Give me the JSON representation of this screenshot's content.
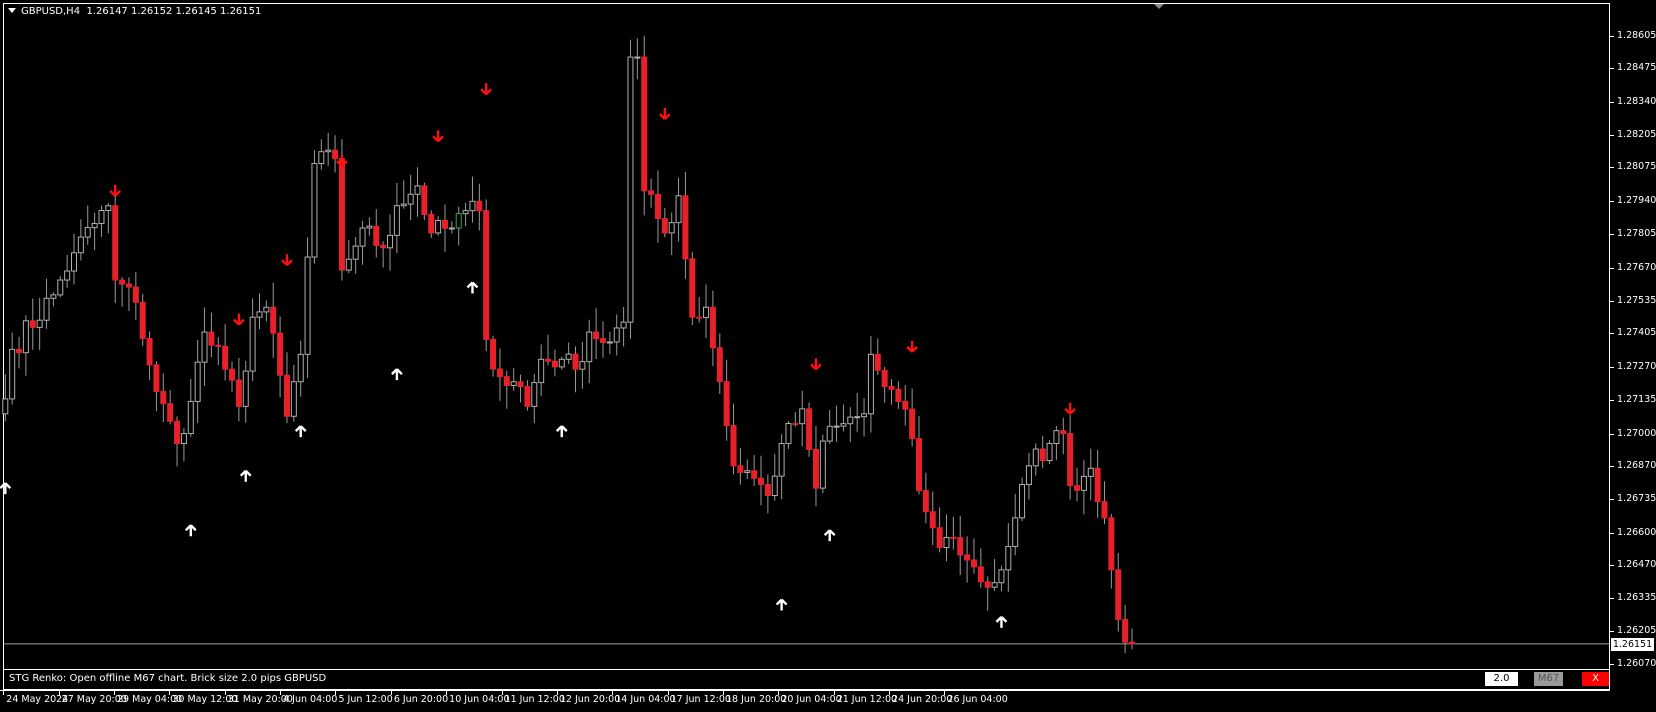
{
  "header": {
    "symbol": "GBPUSD,H4",
    "ohlc": "1.26147 1.26152 1.26145 1.26151"
  },
  "panel": {
    "message": "STG Renko: Open offline M67 chart. Brick size 2.0 pips GBPUSD",
    "brick_value": "2.0",
    "timeframe_button": "M67",
    "close_button": "X"
  },
  "colors": {
    "bear": "#e8202a",
    "bull_border": "#b0b0b0",
    "wick": "#9a9a9a",
    "bull_special": "#2ea84a",
    "down_arrow": "#ff1010",
    "up_arrow": "#ffffff",
    "price_line": "#9aa0aa"
  },
  "chart_data": {
    "type": "candlestick",
    "title": "GBPUSD,H4",
    "current_price": "1.26151",
    "ylim": [
      1.2607,
      1.28605
    ],
    "yticks": [
      "1.28605",
      "1.28475",
      "1.28340",
      "1.28205",
      "1.28075",
      "1.27940",
      "1.27805",
      "1.27670",
      "1.27535",
      "1.27405",
      "1.27270",
      "1.27135",
      "1.27000",
      "1.26870",
      "1.26735",
      "1.26600",
      "1.26470",
      "1.26335",
      "1.26205",
      "1.26070"
    ],
    "xticks": [
      "24 May 2024",
      "27 May 20:00",
      "29 May 04:00",
      "30 May 12:00",
      "31 May 20:00",
      "4 Jun 04:00",
      "5 Jun 12:00",
      "6 Jun 20:00",
      "10 Jun 04:00",
      "11 Jun 12:00",
      "12 Jun 20:00",
      "14 Jun 04:00",
      "17 Jun 12:00",
      "18 Jun 20:00",
      "20 Jun 04:00",
      "21 Jun 12:00",
      "24 Jun 20:00",
      "26 Jun 04:00"
    ],
    "bars_per_xtick": 8,
    "bar_count": 165,
    "close_path": [
      [
        0,
        1.2714
      ],
      [
        1,
        1.2734
      ],
      [
        7,
        1.2756
      ],
      [
        10,
        1.2773
      ],
      [
        15,
        1.2792
      ],
      [
        16,
        1.2762
      ],
      [
        19,
        1.2753
      ],
      [
        22,
        1.2717
      ],
      [
        25,
        1.2696
      ],
      [
        27,
        1.2713
      ],
      [
        29,
        1.2741
      ],
      [
        32,
        1.2726
      ],
      [
        34,
        1.2711
      ],
      [
        36,
        1.2747
      ],
      [
        38,
        1.2751
      ],
      [
        41,
        1.2707
      ],
      [
        43,
        1.2732
      ],
      [
        45,
        1.2809
      ],
      [
        48,
        1.2811
      ],
      [
        49,
        1.2766
      ],
      [
        52,
        1.2783
      ],
      [
        55,
        1.2775
      ],
      [
        57,
        1.2792
      ],
      [
        60,
        1.28
      ],
      [
        62,
        1.2781
      ],
      [
        65,
        1.2783
      ],
      [
        67,
        1.279
      ],
      [
        69,
        1.279
      ],
      [
        70,
        1.2738
      ],
      [
        72,
        1.2723
      ],
      [
        75,
        1.2719
      ],
      [
        76,
        1.2711
      ],
      [
        78,
        1.273
      ],
      [
        81,
        1.273
      ],
      [
        83,
        1.2726
      ],
      [
        85,
        1.2741
      ],
      [
        88,
        1.2737
      ],
      [
        90,
        1.2745
      ],
      [
        91,
        1.2852
      ],
      [
        92,
        1.2852
      ],
      [
        93,
        1.2798
      ],
      [
        96,
        1.2781
      ],
      [
        98,
        1.2796
      ],
      [
        100,
        1.2747
      ],
      [
        102,
        1.2751
      ],
      [
        104,
        1.2721
      ],
      [
        106,
        1.2687
      ],
      [
        108,
        1.2685
      ],
      [
        111,
        1.2675
      ],
      [
        113,
        1.2696
      ],
      [
        115,
        1.2704
      ],
      [
        116,
        1.271
      ],
      [
        118,
        1.2678
      ],
      [
        119,
        1.2697
      ],
      [
        122,
        1.2704
      ],
      [
        125,
        1.2708
      ],
      [
        126,
        1.2732
      ],
      [
        128,
        1.2719
      ],
      [
        130,
        1.2713
      ],
      [
        132,
        1.2698
      ],
      [
        133,
        1.2677
      ],
      [
        135,
        1.2662
      ],
      [
        136,
        1.2654
      ],
      [
        138,
        1.2658
      ],
      [
        140,
        1.2649
      ],
      [
        143,
        1.2638
      ],
      [
        145,
        1.2645
      ],
      [
        147,
        1.2666
      ],
      [
        149,
        1.2687
      ],
      [
        152,
        1.2696
      ],
      [
        154,
        1.27
      ],
      [
        155,
        1.2679
      ],
      [
        158,
        1.2686
      ],
      [
        160,
        1.2666
      ],
      [
        161,
        1.2645
      ],
      [
        162,
        1.2625
      ],
      [
        164,
        1.26151
      ]
    ],
    "sell_signals": [
      [
        16,
        1.2798
      ],
      [
        34,
        1.2746
      ],
      [
        41,
        1.277
      ],
      [
        49,
        1.281
      ],
      [
        63,
        1.282
      ],
      [
        70,
        1.2839
      ],
      [
        96,
        1.2829
      ],
      [
        118,
        1.2728
      ],
      [
        132,
        1.2735
      ],
      [
        155,
        1.271
      ]
    ],
    "buy_signals": [
      [
        0,
        1.2678
      ],
      [
        27,
        1.2661
      ],
      [
        35,
        1.2683
      ],
      [
        43,
        1.2701
      ],
      [
        57,
        1.2724
      ],
      [
        68,
        1.2759
      ],
      [
        81,
        1.2701
      ],
      [
        113,
        1.2631
      ],
      [
        120,
        1.2659
      ],
      [
        145,
        1.2624
      ]
    ]
  }
}
